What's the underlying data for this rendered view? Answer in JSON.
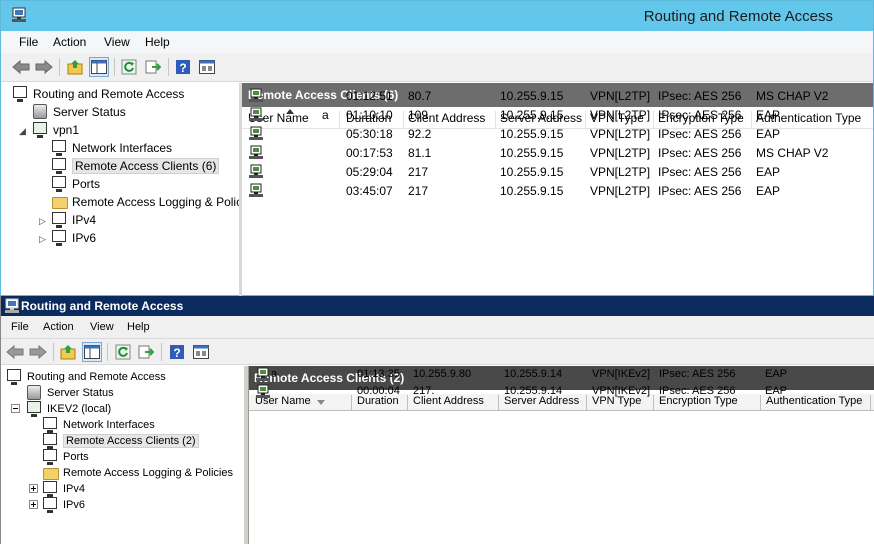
{
  "window1": {
    "title": "Routing and Remote Access",
    "menu": [
      "File",
      "Action",
      "View",
      "Help"
    ],
    "tree": {
      "root": "Routing and Remote Access",
      "server_status": "Server Status",
      "server": "vpn1",
      "children": [
        "Network Interfaces",
        "Remote Access Clients (6)",
        "Ports",
        "Remote Access Logging & Polic",
        "IPv4",
        "IPv6"
      ]
    },
    "panel_title": "Remote Access Clients (6)",
    "columns": [
      "User Name",
      "Duration",
      "Client Address",
      "Server Address",
      "VPN Type",
      "Encryption Type",
      "Authentication Type"
    ],
    "rows": [
      {
        "user": "",
        "duration": "01:12:51",
        "client": "80.7",
        "server": "10.255.9.15",
        "vpn": "VPN[L2TP]",
        "enc": "IPsec: AES 256",
        "auth": "MS CHAP V2"
      },
      {
        "user": "a",
        "duration": "01:10:10",
        "client": "109",
        "server": "10.255.9.15",
        "vpn": "VPN[L2TP]",
        "enc": "IPsec: AES 256",
        "auth": "EAP"
      },
      {
        "user": "",
        "duration": "05:30:18",
        "client": "92.2",
        "server": "10.255.9.15",
        "vpn": "VPN[L2TP]",
        "enc": "IPsec: AES 256",
        "auth": "EAP"
      },
      {
        "user": "",
        "duration": "00:17:53",
        "client": "81.1",
        "server": "10.255.9.15",
        "vpn": "VPN[L2TP]",
        "enc": "IPsec: AES 256",
        "auth": "MS CHAP V2"
      },
      {
        "user": "",
        "duration": "05:29:04",
        "client": "217",
        "server": "10.255.9.15",
        "vpn": "VPN[L2TP]",
        "enc": "IPsec: AES 256",
        "auth": "EAP"
      },
      {
        "user": "",
        "duration": "03:45:07",
        "client": "217",
        "server": "10.255.9.15",
        "vpn": "VPN[L2TP]",
        "enc": "IPsec: AES 256",
        "auth": "EAP"
      }
    ]
  },
  "window2": {
    "title": "Routing and Remote Access",
    "menu": [
      "File",
      "Action",
      "View",
      "Help"
    ],
    "tree": {
      "root": "Routing and Remote Access",
      "server_status": "Server Status",
      "server": "IKEV2 (local)",
      "children": [
        "Network Interfaces",
        "Remote Access Clients (2)",
        "Ports",
        "Remote Access Logging & Policies",
        "IPv4",
        "IPv6"
      ]
    },
    "panel_title": "Remote Access Clients (2)",
    "columns": [
      "User Name",
      "Duration",
      "Client Address",
      "Server Address",
      "VPN Type",
      "Encryption Type",
      "Authentication Type"
    ],
    "rows": [
      {
        "user": "a",
        "duration": "01:13:35",
        "client": "10.255.9.80",
        "server": "10.255.9.14",
        "vpn": "VPN[IKEv2]",
        "enc": "IPsec: AES 256",
        "auth": "EAP"
      },
      {
        "user": "",
        "duration": "00:00:04",
        "client": "217.",
        "server": "10.255.9.14",
        "vpn": "VPN[IKEv2]",
        "enc": "IPsec: AES 256",
        "auth": "EAP"
      }
    ]
  },
  "colors": {
    "titlebar_w1": "#63c7ec",
    "titlebar_w2": "#0b2b5e",
    "panel_header": "#6d6d6d"
  },
  "icons": [
    "back-arrow-icon",
    "forward-arrow-icon",
    "up-folder-icon",
    "show-hide-tree-icon",
    "refresh-icon",
    "export-list-icon",
    "help-icon",
    "mmc-pane-icon"
  ]
}
